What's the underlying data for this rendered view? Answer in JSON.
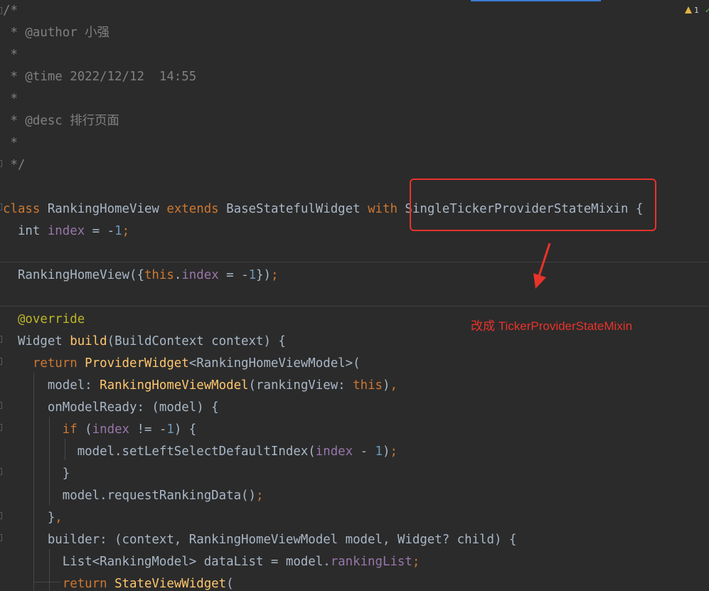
{
  "editor": {
    "warning_count": "1",
    "accent_color": "#e8332b",
    "lines": [
      {
        "id": "l1",
        "tokens": [
          {
            "c": "t-comment",
            "t": "/*"
          }
        ]
      },
      {
        "id": "l2",
        "tokens": [
          {
            "c": "t-comment",
            "t": " * @author 小强"
          }
        ]
      },
      {
        "id": "l3",
        "tokens": [
          {
            "c": "t-comment",
            "t": " *"
          }
        ]
      },
      {
        "id": "l4",
        "tokens": [
          {
            "c": "t-comment",
            "t": " * @time 2022/12/12  14:55"
          }
        ]
      },
      {
        "id": "l5",
        "tokens": [
          {
            "c": "t-comment",
            "t": " *"
          }
        ]
      },
      {
        "id": "l6",
        "tokens": [
          {
            "c": "t-comment",
            "t": " * @desc 排行页面"
          }
        ]
      },
      {
        "id": "l7",
        "tokens": [
          {
            "c": "t-comment",
            "t": " *"
          }
        ]
      },
      {
        "id": "l8",
        "tokens": [
          {
            "c": "t-comment",
            "t": " */"
          }
        ]
      },
      {
        "id": "l9",
        "tokens": []
      },
      {
        "id": "l10",
        "tokens": [
          {
            "c": "t-kw",
            "t": "class "
          },
          {
            "c": "t-plain",
            "t": "RankingHomeView "
          },
          {
            "c": "t-kw",
            "t": "extends "
          },
          {
            "c": "t-plain",
            "t": "BaseStatefulWidget "
          },
          {
            "c": "t-kw",
            "t": "with "
          },
          {
            "c": "t-plain",
            "t": "SingleTickerProviderStateMixin {"
          }
        ]
      },
      {
        "id": "l11",
        "tokens": [
          {
            "c": "t-plain",
            "t": "  int "
          },
          {
            "c": "t-field",
            "t": "index"
          },
          {
            "c": "t-plain",
            "t": " = -"
          },
          {
            "c": "t-num",
            "t": "1"
          },
          {
            "c": "t-punct",
            "t": ";"
          }
        ]
      },
      {
        "id": "l12",
        "tokens": []
      },
      {
        "id": "l13",
        "tokens": [
          {
            "c": "t-plain",
            "t": "  RankingHomeView({"
          },
          {
            "c": "t-kw",
            "t": "this"
          },
          {
            "c": "t-plain",
            "t": "."
          },
          {
            "c": "t-field",
            "t": "index"
          },
          {
            "c": "t-plain",
            "t": " = -"
          },
          {
            "c": "t-num",
            "t": "1"
          },
          {
            "c": "t-plain",
            "t": "})"
          },
          {
            "c": "t-punct",
            "t": ";"
          }
        ]
      },
      {
        "id": "l14",
        "tokens": []
      },
      {
        "id": "l15",
        "tokens": [
          {
            "c": "t-anno",
            "t": "  @override"
          }
        ]
      },
      {
        "id": "l16",
        "tokens": [
          {
            "c": "t-plain",
            "t": "  Widget "
          },
          {
            "c": "t-fn",
            "t": "build"
          },
          {
            "c": "t-plain",
            "t": "(BuildContext context) {"
          }
        ]
      },
      {
        "id": "l17",
        "tokens": [
          {
            "c": "t-kw",
            "t": "    return "
          },
          {
            "c": "t-fn",
            "t": "ProviderWidget"
          },
          {
            "c": "t-plain",
            "t": "<RankingHomeViewModel>("
          }
        ]
      },
      {
        "id": "l18",
        "tokens": [
          {
            "c": "t-plain",
            "t": "      model: "
          },
          {
            "c": "t-fn",
            "t": "RankingHomeViewModel"
          },
          {
            "c": "t-plain",
            "t": "(rankingView: "
          },
          {
            "c": "t-kw",
            "t": "this"
          },
          {
            "c": "t-plain",
            "t": ")"
          },
          {
            "c": "t-punct",
            "t": ","
          }
        ]
      },
      {
        "id": "l19",
        "tokens": [
          {
            "c": "t-plain",
            "t": "      onModelReady: (model) {"
          }
        ]
      },
      {
        "id": "l20",
        "tokens": [
          {
            "c": "t-kw",
            "t": "        if "
          },
          {
            "c": "t-plain",
            "t": "("
          },
          {
            "c": "t-field",
            "t": "index"
          },
          {
            "c": "t-plain",
            "t": " != -"
          },
          {
            "c": "t-num",
            "t": "1"
          },
          {
            "c": "t-plain",
            "t": ") {"
          }
        ]
      },
      {
        "id": "l21",
        "tokens": [
          {
            "c": "t-plain",
            "t": "          model.setLeftSelectDefaultIndex("
          },
          {
            "c": "t-field",
            "t": "index"
          },
          {
            "c": "t-plain",
            "t": " - "
          },
          {
            "c": "t-num",
            "t": "1"
          },
          {
            "c": "t-plain",
            "t": ")"
          },
          {
            "c": "t-punct",
            "t": ";"
          }
        ]
      },
      {
        "id": "l22",
        "tokens": [
          {
            "c": "t-plain",
            "t": "        }"
          }
        ]
      },
      {
        "id": "l23",
        "tokens": [
          {
            "c": "t-plain",
            "t": "        model.requestRankingData()"
          },
          {
            "c": "t-punct",
            "t": ";"
          }
        ]
      },
      {
        "id": "l24",
        "tokens": [
          {
            "c": "t-plain",
            "t": "      }"
          },
          {
            "c": "t-punct",
            "t": ","
          }
        ]
      },
      {
        "id": "l25",
        "tokens": [
          {
            "c": "t-plain",
            "t": "      builder: (context, RankingHomeViewModel model, Widget? child) {"
          }
        ]
      },
      {
        "id": "l26",
        "tokens": [
          {
            "c": "t-plain",
            "t": "        List<RankingModel> dataList = model."
          },
          {
            "c": "t-field",
            "t": "rankingList"
          },
          {
            "c": "t-punct",
            "t": ";"
          }
        ]
      },
      {
        "id": "l27",
        "tokens": [
          {
            "c": "t-kw",
            "t": "        return "
          },
          {
            "c": "t-fn",
            "t": "StateViewWidget"
          },
          {
            "c": "t-plain",
            "t": "("
          }
        ]
      }
    ]
  },
  "annotation": {
    "text": "改成 TickerProviderStateMixin"
  }
}
